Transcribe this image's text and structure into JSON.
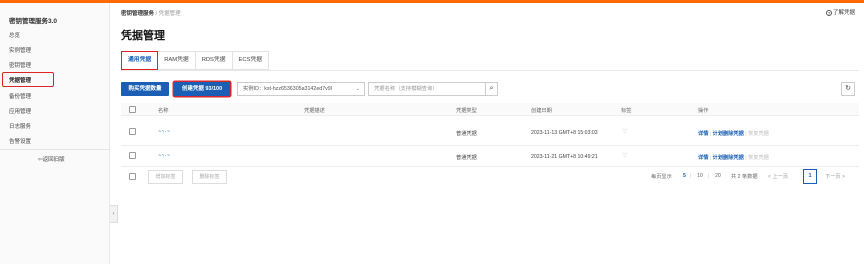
{
  "sidebar": {
    "title": "密钥管理服务3.0",
    "items": [
      {
        "label": "总览"
      },
      {
        "label": "实例管理"
      },
      {
        "label": "密钥管理"
      },
      {
        "label": "凭据管理"
      },
      {
        "label": "备份管理"
      },
      {
        "label": "应用管理"
      },
      {
        "label": "日志服务"
      },
      {
        "label": "告警设置"
      }
    ],
    "back_label": "返回旧版"
  },
  "header": {
    "breadcrumb_root": "密钥管理服务",
    "breadcrumb_sep": "/",
    "breadcrumb_current": "凭据管理",
    "help_label": "了解凭据",
    "page_title": "凭据管理"
  },
  "tabs": [
    {
      "label": "通用凭据"
    },
    {
      "label": "RAM凭据"
    },
    {
      "label": "RDS凭据"
    },
    {
      "label": "ECS凭据"
    }
  ],
  "toolbar": {
    "buy_label": "购买凭据数量",
    "create_label": "创建凭据 93/100",
    "instance_select": "实例ID：kst-hzz6536305a3142ed7v9l",
    "search_placeholder": "凭据名称（支持模糊查询）"
  },
  "table": {
    "headers": [
      "名称",
      "凭据描述",
      "凭据类型",
      "创建日期",
      "标签",
      "操作"
    ],
    "rows": [
      {
        "name": "~~·~",
        "description": "",
        "type": "普通凭据",
        "created": "2023-11-13 GMT+8 15:03:03",
        "actions": {
          "detail": "详情",
          "schedule_delete": "计划删除凭据",
          "restore": "恢复凭据"
        }
      },
      {
        "name": "~~·~",
        "description": "",
        "type": "普通凭据",
        "created": "2023-11-21 GMT+8 10:49:21",
        "actions": {
          "detail": "详情",
          "schedule_delete": "计划删除凭据",
          "restore": "恢复凭据"
        }
      }
    ]
  },
  "footer": {
    "add_tag_label": "增加标签",
    "remove_tag_label": "删除标签",
    "page_size_label": "每页显示",
    "page_sizes": [
      "5",
      "10",
      "20"
    ],
    "total_label": "共 2 条数据",
    "prev_label": "< 上一页",
    "current_page": "1",
    "next_label": "下一页 >"
  },
  "colors": {
    "primary": "#1a5fb4",
    "highlight_border": "#d9262c",
    "brand_bar": "#ff6a00"
  }
}
